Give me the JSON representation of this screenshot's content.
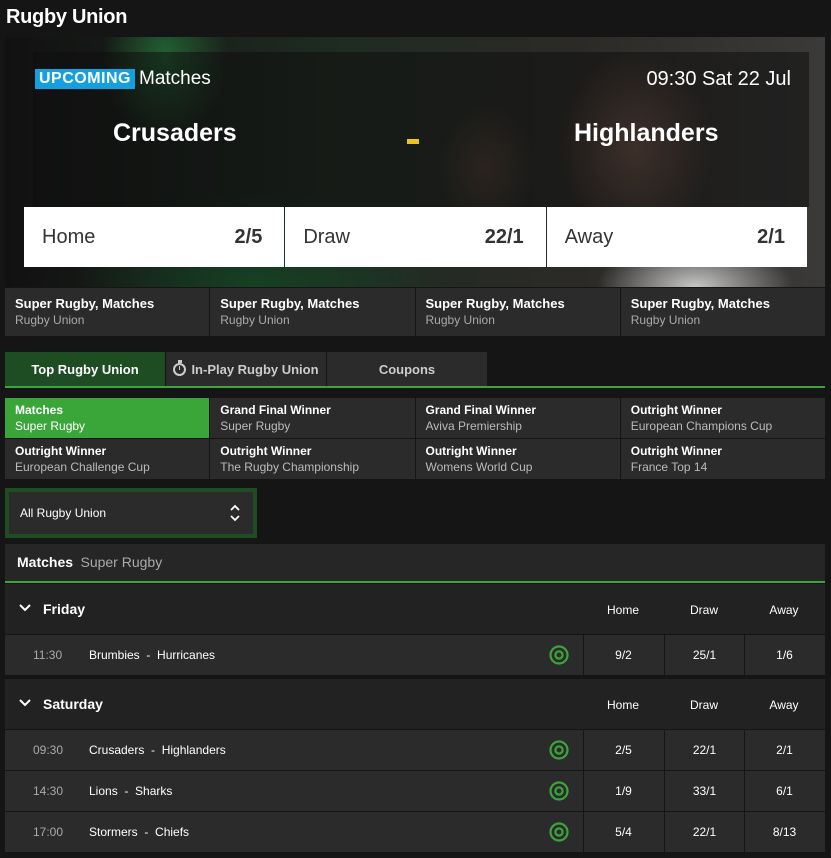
{
  "page": {
    "title": "Rugby Union"
  },
  "hero": {
    "badge": "UPCOMING",
    "badge_text": "Matches",
    "time": "09:30 Sat 22 Jul",
    "home_team": "Crusaders",
    "away_team": "Highlanders",
    "odds": [
      {
        "label": "Home",
        "value": "2/5"
      },
      {
        "label": "Draw",
        "value": "22/1"
      },
      {
        "label": "Away",
        "value": "2/1"
      }
    ]
  },
  "league_strip": [
    {
      "title": "Super Rugby, Matches",
      "sub": "Rugby Union"
    },
    {
      "title": "Super Rugby, Matches",
      "sub": "Rugby Union"
    },
    {
      "title": "Super Rugby, Matches",
      "sub": "Rugby Union"
    },
    {
      "title": "Super Rugby, Matches",
      "sub": "Rugby Union"
    }
  ],
  "tabs": [
    {
      "label": "Top Rugby Union"
    },
    {
      "label": "In-Play Rugby Union"
    },
    {
      "label": "Coupons"
    }
  ],
  "markets": [
    {
      "title": "Matches",
      "sub": "Super Rugby"
    },
    {
      "title": "Grand Final Winner",
      "sub": "Super Rugby"
    },
    {
      "title": "Grand Final Winner",
      "sub": "Aviva Premiership"
    },
    {
      "title": "Outright Winner",
      "sub": "European Champions Cup"
    },
    {
      "title": "Outright Winner",
      "sub": "European Challenge Cup"
    },
    {
      "title": "Outright Winner",
      "sub": "The Rugby Championship"
    },
    {
      "title": "Outright Winner",
      "sub": "Womens World Cup"
    },
    {
      "title": "Outright Winner",
      "sub": "France Top 14"
    }
  ],
  "filter": {
    "selected": "All Rugby Union"
  },
  "section": {
    "title": "Matches",
    "sub": "Super Rugby"
  },
  "columns": {
    "home": "Home",
    "draw": "Draw",
    "away": "Away"
  },
  "days": [
    {
      "name": "Friday",
      "matches": [
        {
          "time": "11:30",
          "home": "Brumbies",
          "sep": "-",
          "away": "Hurricanes",
          "odds": [
            "9/2",
            "25/1",
            "1/6"
          ]
        }
      ]
    },
    {
      "name": "Saturday",
      "matches": [
        {
          "time": "09:30",
          "home": "Crusaders",
          "sep": "-",
          "away": "Highlanders",
          "odds": [
            "2/5",
            "22/1",
            "2/1"
          ]
        },
        {
          "time": "14:30",
          "home": "Lions",
          "sep": "-",
          "away": "Sharks",
          "odds": [
            "1/9",
            "33/1",
            "6/1"
          ]
        },
        {
          "time": "17:00",
          "home": "Stormers",
          "sep": "-",
          "away": "Chiefs",
          "odds": [
            "5/4",
            "22/1",
            "8/13"
          ]
        }
      ]
    }
  ],
  "colors": {
    "accent_green": "#3aa63a",
    "dark_green": "#1e4d24",
    "badge_blue": "#12a0e0",
    "separator_yellow": "#f0c419"
  }
}
